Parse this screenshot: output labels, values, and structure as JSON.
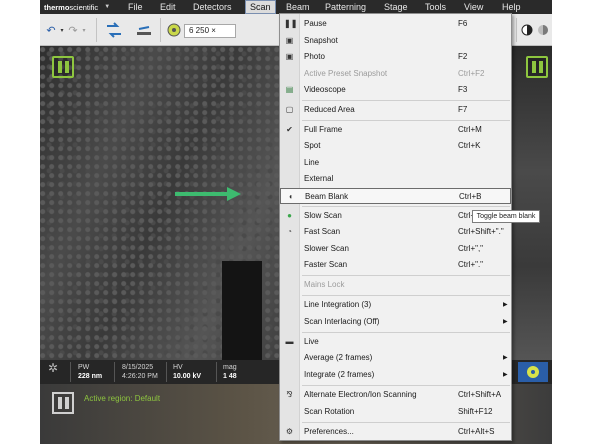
{
  "menubar": {
    "brand": {
      "part1": "thermo",
      "part2": "scientific"
    },
    "items": [
      "File",
      "Edit",
      "Detectors",
      "Scan",
      "Beam",
      "Patterning",
      "Stage",
      "Tools",
      "View",
      "Help"
    ],
    "active": "Scan"
  },
  "toolbar": {
    "magnification": "6 250 ×"
  },
  "status_bar": {
    "pw_label": "PW",
    "pw_value": "228 nm",
    "date": "8/15/2025",
    "time": "4:26:20 PM",
    "hv_label": "HV",
    "hv_value": "10.00 kV",
    "mag_label": "mag",
    "mag_value": "1 48"
  },
  "bottom": {
    "active_region": "Active region: Default"
  },
  "scan_menu": {
    "items": [
      {
        "icon": "pause-icon",
        "label": "Pause",
        "shortcut": "F6"
      },
      {
        "icon": "camera-icon",
        "label": "Snapshot",
        "shortcut": ""
      },
      {
        "icon": "photo-icon",
        "label": "Photo",
        "shortcut": "F2"
      },
      {
        "icon": "",
        "label": "Active Preset Snapshot",
        "shortcut": "Ctrl+F2",
        "disabled": true
      },
      {
        "icon": "videoscope-icon",
        "label": "Videoscope",
        "shortcut": "F3"
      },
      {
        "icon": "reduced-area-icon",
        "label": "Reduced Area",
        "shortcut": "F7"
      },
      {
        "icon": "check-icon",
        "label": "Full Frame",
        "shortcut": "Ctrl+M"
      },
      {
        "icon": "",
        "label": "Spot",
        "shortcut": "Ctrl+K"
      },
      {
        "icon": "",
        "label": "Line",
        "shortcut": ""
      },
      {
        "icon": "",
        "label": "External",
        "shortcut": ""
      },
      {
        "icon": "beam-blank-icon",
        "label": "Beam Blank",
        "shortcut": "Ctrl+B"
      },
      {
        "icon": "slow-scan-icon",
        "label": "Slow Scan",
        "shortcut": "Ctrl+Shift+\",\""
      },
      {
        "icon": "fast-scan-icon",
        "label": "Fast Scan",
        "shortcut": "Ctrl+Shift+\".\""
      },
      {
        "icon": "",
        "label": "Slower Scan",
        "shortcut": "Ctrl+\",\""
      },
      {
        "icon": "",
        "label": "Faster Scan",
        "shortcut": "Ctrl+\".\""
      },
      {
        "icon": "",
        "label": "Mains Lock",
        "shortcut": "",
        "disabled": true
      },
      {
        "icon": "",
        "label": "Line Integration (3)",
        "shortcut": "",
        "submenu": true
      },
      {
        "icon": "",
        "label": "Scan Interlacing (Off)",
        "shortcut": "",
        "submenu": true
      },
      {
        "icon": "live-icon",
        "label": "Live",
        "shortcut": ""
      },
      {
        "icon": "",
        "label": "Average (2 frames)",
        "shortcut": "",
        "submenu": true
      },
      {
        "icon": "",
        "label": "Integrate (2 frames)",
        "shortcut": "",
        "submenu": true
      },
      {
        "icon": "alternate-scan-icon",
        "label": "Alternate Electron/Ion Scanning",
        "shortcut": "Ctrl+Shift+A"
      },
      {
        "icon": "",
        "label": "Scan Rotation",
        "shortcut": "Shift+F12"
      },
      {
        "icon": "preferences-icon",
        "label": "Preferences...",
        "shortcut": "Ctrl+Alt+S"
      }
    ]
  },
  "tooltip": "Toggle beam blank",
  "colors": {
    "accent_green": "#8ec63f",
    "arrow_green": "#3dbb6f",
    "menu_bg": "#f1f1f1"
  }
}
